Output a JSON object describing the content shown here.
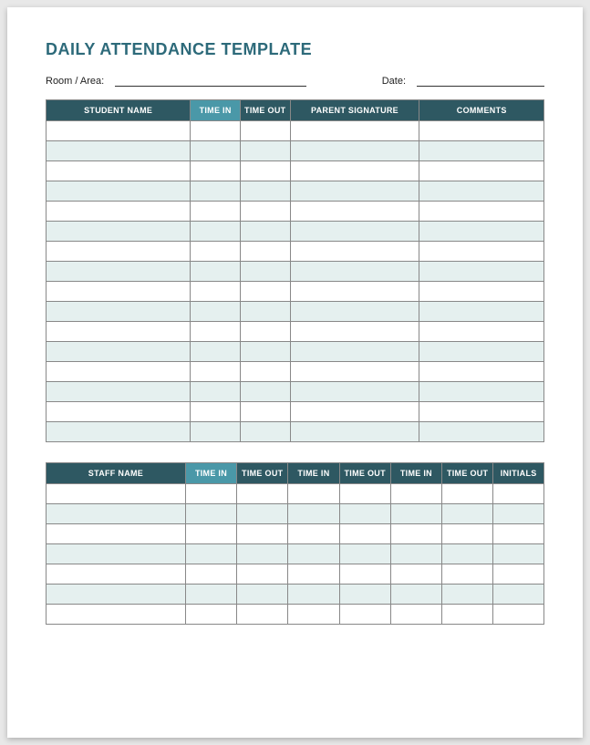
{
  "title": "DAILY ATTENDANCE TEMPLATE",
  "meta": {
    "room_label": "Room / Area:",
    "room_value": "",
    "date_label": "Date:",
    "date_value": ""
  },
  "student_table": {
    "headers": {
      "name": "STUDENT NAME",
      "time_in": "TIME IN",
      "time_out": "TIME OUT",
      "parent_sig": "PARENT SIGNATURE",
      "comments": "COMMENTS"
    },
    "rows": [
      {
        "name": "",
        "time_in": "",
        "time_out": "",
        "parent_sig": "",
        "comments": ""
      },
      {
        "name": "",
        "time_in": "",
        "time_out": "",
        "parent_sig": "",
        "comments": ""
      },
      {
        "name": "",
        "time_in": "",
        "time_out": "",
        "parent_sig": "",
        "comments": ""
      },
      {
        "name": "",
        "time_in": "",
        "time_out": "",
        "parent_sig": "",
        "comments": ""
      },
      {
        "name": "",
        "time_in": "",
        "time_out": "",
        "parent_sig": "",
        "comments": ""
      },
      {
        "name": "",
        "time_in": "",
        "time_out": "",
        "parent_sig": "",
        "comments": ""
      },
      {
        "name": "",
        "time_in": "",
        "time_out": "",
        "parent_sig": "",
        "comments": ""
      },
      {
        "name": "",
        "time_in": "",
        "time_out": "",
        "parent_sig": "",
        "comments": ""
      },
      {
        "name": "",
        "time_in": "",
        "time_out": "",
        "parent_sig": "",
        "comments": ""
      },
      {
        "name": "",
        "time_in": "",
        "time_out": "",
        "parent_sig": "",
        "comments": ""
      },
      {
        "name": "",
        "time_in": "",
        "time_out": "",
        "parent_sig": "",
        "comments": ""
      },
      {
        "name": "",
        "time_in": "",
        "time_out": "",
        "parent_sig": "",
        "comments": ""
      },
      {
        "name": "",
        "time_in": "",
        "time_out": "",
        "parent_sig": "",
        "comments": ""
      },
      {
        "name": "",
        "time_in": "",
        "time_out": "",
        "parent_sig": "",
        "comments": ""
      },
      {
        "name": "",
        "time_in": "",
        "time_out": "",
        "parent_sig": "",
        "comments": ""
      },
      {
        "name": "",
        "time_in": "",
        "time_out": "",
        "parent_sig": "",
        "comments": ""
      }
    ]
  },
  "staff_table": {
    "headers": {
      "name": "STAFF NAME",
      "time_in": "TIME IN",
      "time_out": "TIME OUT",
      "initials": "INITIALS"
    },
    "rows": [
      {
        "name": "",
        "t1": "",
        "t2": "",
        "t3": "",
        "t4": "",
        "t5": "",
        "t6": "",
        "initials": ""
      },
      {
        "name": "",
        "t1": "",
        "t2": "",
        "t3": "",
        "t4": "",
        "t5": "",
        "t6": "",
        "initials": ""
      },
      {
        "name": "",
        "t1": "",
        "t2": "",
        "t3": "",
        "t4": "",
        "t5": "",
        "t6": "",
        "initials": ""
      },
      {
        "name": "",
        "t1": "",
        "t2": "",
        "t3": "",
        "t4": "",
        "t5": "",
        "t6": "",
        "initials": ""
      },
      {
        "name": "",
        "t1": "",
        "t2": "",
        "t3": "",
        "t4": "",
        "t5": "",
        "t6": "",
        "initials": ""
      },
      {
        "name": "",
        "t1": "",
        "t2": "",
        "t3": "",
        "t4": "",
        "t5": "",
        "t6": "",
        "initials": ""
      },
      {
        "name": "",
        "t1": "",
        "t2": "",
        "t3": "",
        "t4": "",
        "t5": "",
        "t6": "",
        "initials": ""
      }
    ]
  }
}
